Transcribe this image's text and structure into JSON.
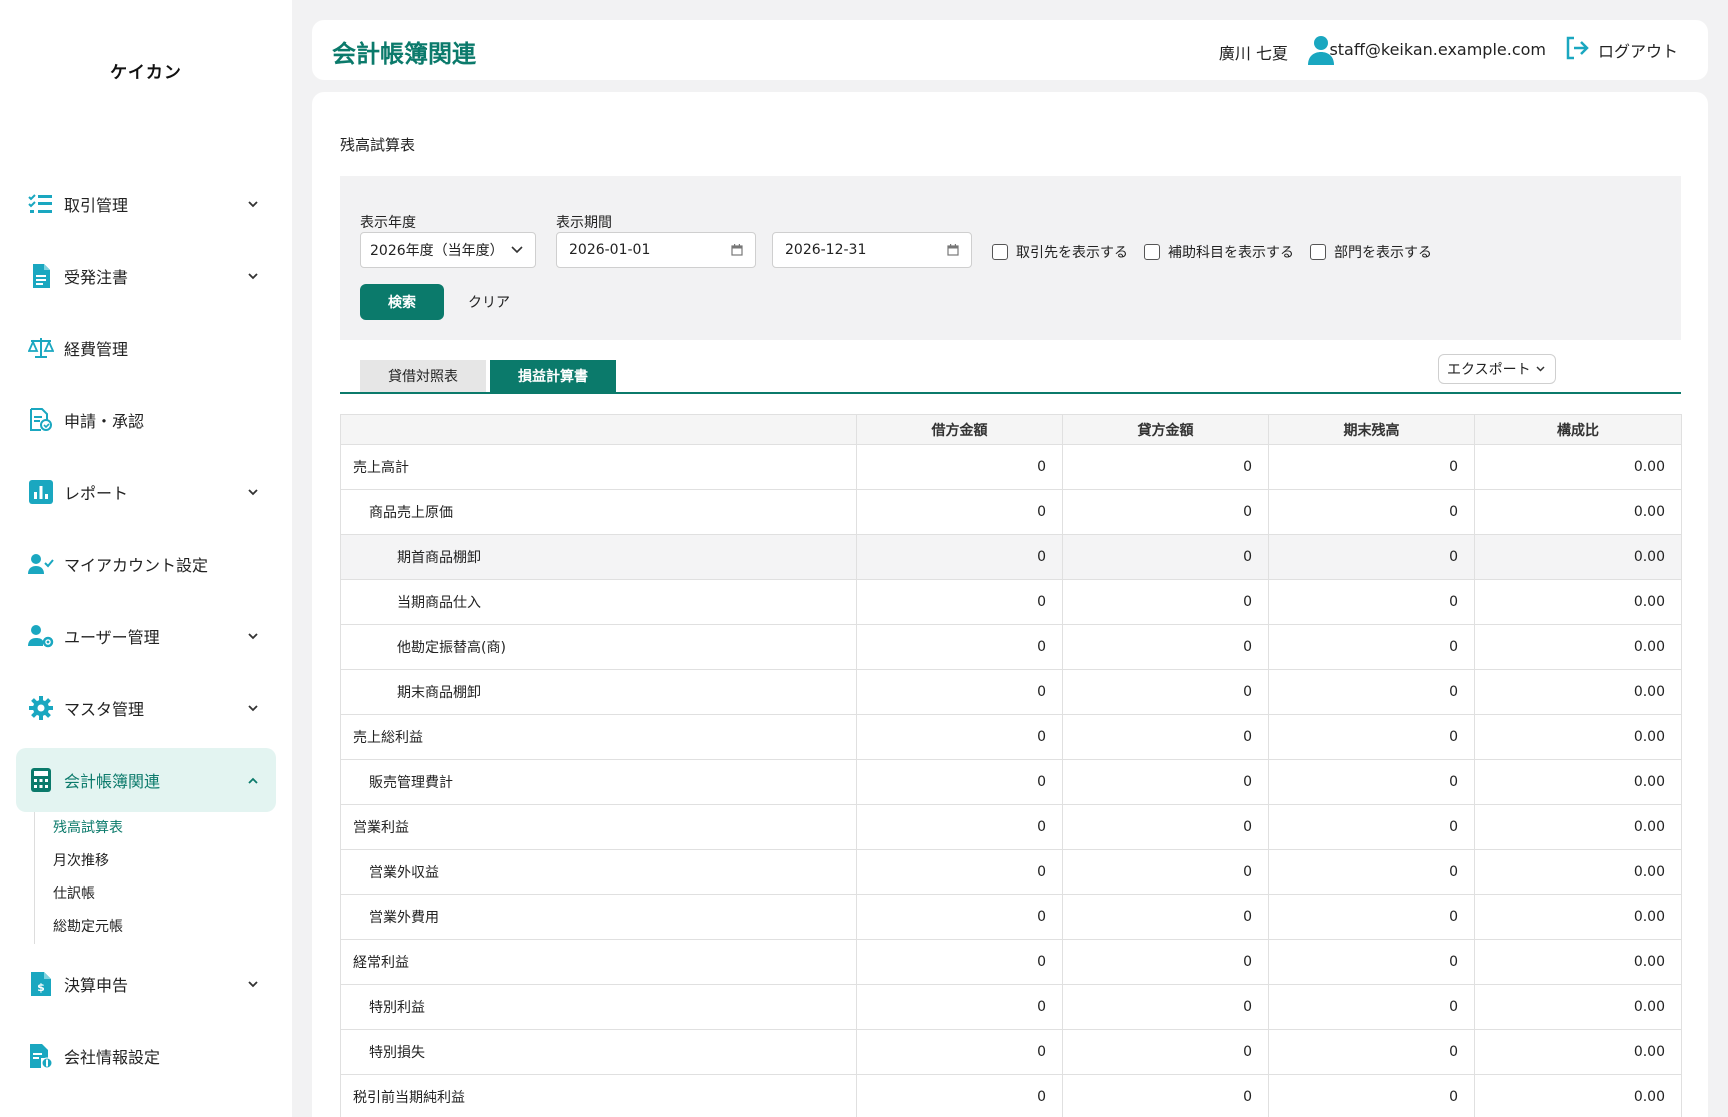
{
  "app": {
    "logo": "ケイカン"
  },
  "colors": {
    "brand": "#0b7a6b",
    "icon": "#1aa7c0",
    "active_bg": "#e3f4f1"
  },
  "sidebar": {
    "items": [
      {
        "label": "取引管理",
        "icon": "checklist-icon",
        "chevron": "down"
      },
      {
        "label": "受発注書",
        "icon": "document-icon",
        "chevron": "down"
      },
      {
        "label": "経費管理",
        "icon": "scale-icon",
        "chevron": ""
      },
      {
        "label": "申請・承認",
        "icon": "approval-icon",
        "chevron": ""
      },
      {
        "label": "レポート",
        "icon": "bar-chart-icon",
        "chevron": "down"
      },
      {
        "label": "マイアカウント設定",
        "icon": "user-check-icon",
        "chevron": ""
      },
      {
        "label": "ユーザー管理",
        "icon": "user-gear-icon",
        "chevron": "down"
      },
      {
        "label": "マスタ管理",
        "icon": "gear-icon",
        "chevron": "down"
      },
      {
        "label": "会計帳簿関連",
        "icon": "calculator-icon",
        "chevron": "up",
        "active": true
      },
      {
        "label": "決算申告",
        "icon": "tax-file-icon",
        "chevron": "down"
      },
      {
        "label": "会社情報設定",
        "icon": "company-file-icon",
        "chevron": ""
      }
    ],
    "submenu": [
      "残高試算表",
      "月次推移",
      "仕訳帳",
      "総勘定元帳"
    ]
  },
  "header": {
    "title": "会計帳簿関連",
    "user_name": "廣川 七夏",
    "email": "staff@keikan.example.com",
    "logout": "ログアウト"
  },
  "main": {
    "section_title": "残高試算表",
    "filter": {
      "year_label": "表示年度",
      "year_value": "2026年度（当年度）",
      "period_label": "表示期間",
      "date_from": "2026-01-01",
      "date_to": "2026-12-31",
      "checkboxes": [
        "取引先を表示する",
        "補助科目を表示する",
        "部門を表示する"
      ],
      "search": "検索",
      "clear": "クリア"
    },
    "tabs": [
      "貸借対照表",
      "損益計算書"
    ],
    "active_tab": 1,
    "export": "エクスポート",
    "table": {
      "headers": [
        "",
        "借方金額",
        "貸方金額",
        "期末残高",
        "構成比"
      ],
      "rows": [
        {
          "name": "売上高計",
          "level": 0,
          "values": [
            "0",
            "0",
            "0",
            "0.00"
          ]
        },
        {
          "name": "商品売上原価",
          "level": 1,
          "values": [
            "0",
            "0",
            "0",
            "0.00"
          ]
        },
        {
          "name": "期首商品棚卸",
          "level": 2,
          "values": [
            "0",
            "0",
            "0",
            "0.00"
          ],
          "highlight": true
        },
        {
          "name": "当期商品仕入",
          "level": 2,
          "values": [
            "0",
            "0",
            "0",
            "0.00"
          ]
        },
        {
          "name": "他勘定振替高(商)",
          "level": 2,
          "values": [
            "0",
            "0",
            "0",
            "0.00"
          ]
        },
        {
          "name": "期末商品棚卸",
          "level": 2,
          "values": [
            "0",
            "0",
            "0",
            "0.00"
          ]
        },
        {
          "name": "売上総利益",
          "level": 0,
          "values": [
            "0",
            "0",
            "0",
            "0.00"
          ]
        },
        {
          "name": "販売管理費計",
          "level": 1,
          "values": [
            "0",
            "0",
            "0",
            "0.00"
          ]
        },
        {
          "name": "営業利益",
          "level": 0,
          "values": [
            "0",
            "0",
            "0",
            "0.00"
          ]
        },
        {
          "name": "営業外収益",
          "level": 1,
          "values": [
            "0",
            "0",
            "0",
            "0.00"
          ]
        },
        {
          "name": "営業外費用",
          "level": 1,
          "values": [
            "0",
            "0",
            "0",
            "0.00"
          ]
        },
        {
          "name": "経常利益",
          "level": 0,
          "values": [
            "0",
            "0",
            "0",
            "0.00"
          ]
        },
        {
          "name": "特別利益",
          "level": 1,
          "values": [
            "0",
            "0",
            "0",
            "0.00"
          ]
        },
        {
          "name": "特別損失",
          "level": 1,
          "values": [
            "0",
            "0",
            "0",
            "0.00"
          ]
        },
        {
          "name": "税引前当期純利益",
          "level": 0,
          "values": [
            "0",
            "0",
            "0",
            "0.00"
          ]
        }
      ]
    }
  }
}
